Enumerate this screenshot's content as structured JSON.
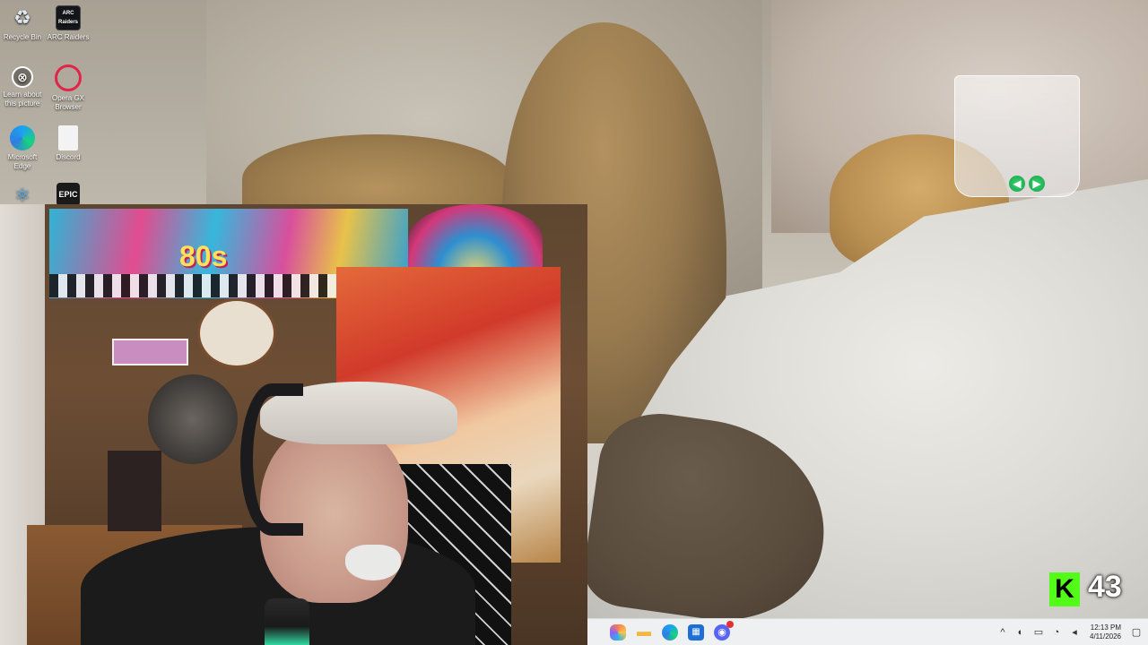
{
  "desktop": {
    "icons": [
      {
        "label": "Recycle Bin",
        "icon": "recycle-bin-icon",
        "glyph": "♻"
      },
      {
        "label": "ARC Raiders",
        "icon": "arc-raiders-icon",
        "glyph": "ARC Raiders"
      },
      {
        "label": "Learn about this picture",
        "icon": "learn-about-picture-icon",
        "glyph": "⊗"
      },
      {
        "label": "Opera GX Browser",
        "icon": "opera-gx-icon",
        "glyph": ""
      },
      {
        "label": "Microsoft Edge",
        "icon": "edge-icon",
        "glyph": ""
      },
      {
        "label": "Discord",
        "icon": "discord-file-icon",
        "glyph": ""
      },
      {
        "label": "",
        "icon": "blue-app-icon",
        "glyph": "⚛"
      },
      {
        "label": "",
        "icon": "epic-games-icon",
        "glyph": "EPIC"
      }
    ]
  },
  "webcam": {
    "banner_text": "80s"
  },
  "kick": {
    "logo_glyph": "K",
    "viewer_count": "43"
  },
  "glass_widget": {
    "left_arrow": "◀",
    "right_arrow": "▶"
  },
  "taskbar": {
    "apps": [
      {
        "name": "copilot",
        "icon": "copilot-icon"
      },
      {
        "name": "file-explorer",
        "icon": "folder-icon",
        "glyph": "▬"
      },
      {
        "name": "edge",
        "icon": "edge-icon"
      },
      {
        "name": "store",
        "icon": "store-icon",
        "glyph": "▦"
      },
      {
        "name": "discord",
        "icon": "discord-icon",
        "glyph": "◉"
      }
    ],
    "tray": {
      "chevron": "^",
      "time": "12:13 PM",
      "date": "4/11/2026"
    }
  },
  "colors": {
    "kick_green": "#53fc18",
    "taskbar_bg": "#eef0f2"
  }
}
